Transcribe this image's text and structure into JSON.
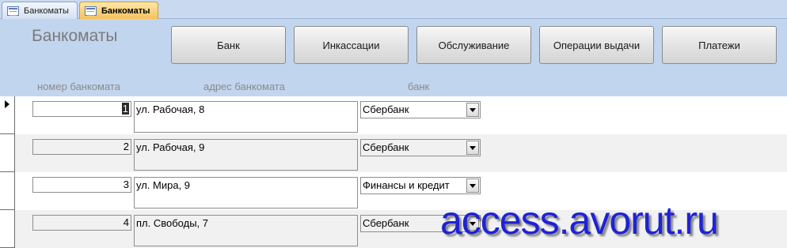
{
  "tabs": [
    {
      "label": "Банкоматы",
      "active": false
    },
    {
      "label": "Банкоматы",
      "active": true
    }
  ],
  "form": {
    "title": "Банкоматы",
    "buttons": [
      {
        "label": "Банк"
      },
      {
        "label": "Инкассации"
      },
      {
        "label": "Обслуживание"
      },
      {
        "label": "Операции выдачи"
      },
      {
        "label": "Платежи"
      }
    ],
    "columns": {
      "number": "номер банкомата",
      "address": "адрес банкомата",
      "bank": "банк"
    }
  },
  "records": [
    {
      "number": "1",
      "address": "ул. Рабочая, 8",
      "bank": "Сбербанк",
      "current": true
    },
    {
      "number": "2",
      "address": "ул. Рабочая, 9",
      "bank": "Сбербанк",
      "current": false
    },
    {
      "number": "3",
      "address": "ул. Мира, 9",
      "bank": "Финансы и кредит",
      "current": false
    },
    {
      "number": "4",
      "address": "пл. Свободы, 7",
      "bank": "Сбербанк",
      "current": false
    }
  ],
  "watermark": "access.avorut.ru",
  "colors": {
    "header_bg": "#c2d5ee",
    "active_tab": "#f6c25b",
    "watermark": "#1e22d6"
  }
}
